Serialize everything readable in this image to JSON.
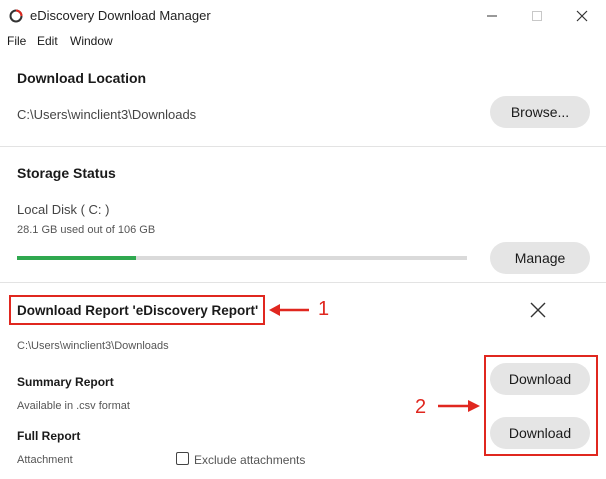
{
  "window": {
    "title": "eDiscovery Download Manager"
  },
  "menu": [
    "File",
    "Edit",
    "Window"
  ],
  "download_location": {
    "heading": "Download Location",
    "path": "C:\\Users\\winclient3\\Downloads",
    "browse_label": "Browse..."
  },
  "storage": {
    "heading": "Storage Status",
    "disk": "Local Disk ( C: )",
    "usage": "28.1 GB used out of 106 GB",
    "used_fraction": 0.265,
    "manage_label": "Manage",
    "bar_color": "#2fa84f"
  },
  "report": {
    "heading": "Download Report 'eDiscovery Report'",
    "path": "C:\\Users\\winclient3\\Downloads",
    "summary_label": "Summary Report",
    "summary_sub": "Available in .csv format",
    "full_label": "Full Report",
    "full_sub": "Attachment",
    "exclude_label": "Exclude attachments",
    "download_label_1": "Download",
    "download_label_2": "Download"
  },
  "callouts": {
    "one": "1",
    "two": "2",
    "color": "#e0271f"
  }
}
